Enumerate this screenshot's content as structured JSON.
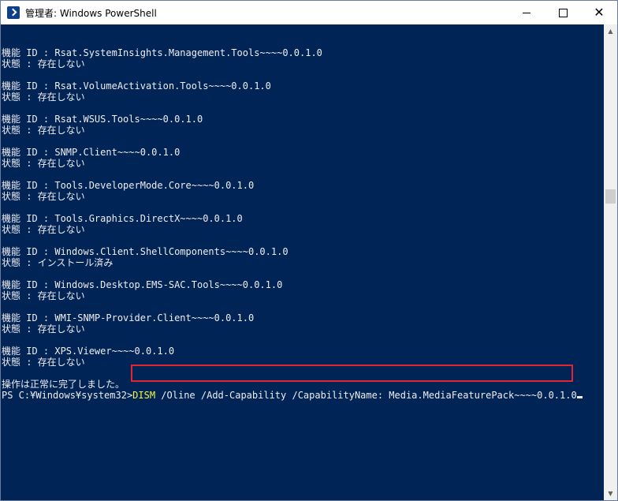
{
  "window": {
    "title": "管理者: Windows PowerShell",
    "controls": {
      "minimize": "",
      "maximize": "",
      "close": "✕"
    }
  },
  "console": {
    "lines": [
      "機能 ID : Rsat.SystemInsights.Management.Tools~~~~0.0.1.0",
      "状態 : 存在しない",
      "",
      "機能 ID : Rsat.VolumeActivation.Tools~~~~0.0.1.0",
      "状態 : 存在しない",
      "",
      "機能 ID : Rsat.WSUS.Tools~~~~0.0.1.0",
      "状態 : 存在しない",
      "",
      "機能 ID : SNMP.Client~~~~0.0.1.0",
      "状態 : 存在しない",
      "",
      "機能 ID : Tools.DeveloperMode.Core~~~~0.0.1.0",
      "状態 : 存在しない",
      "",
      "機能 ID : Tools.Graphics.DirectX~~~~0.0.1.0",
      "状態 : 存在しない",
      "",
      "機能 ID : Windows.Client.ShellComponents~~~~0.0.1.0",
      "状態 : インストール済み",
      "",
      "機能 ID : Windows.Desktop.EMS-SAC.Tools~~~~0.0.1.0",
      "状態 : 存在しない",
      "",
      "機能 ID : WMI-SNMP-Provider.Client~~~~0.0.1.0",
      "状態 : 存在しない",
      "",
      "機能 ID : XPS.Viewer~~~~0.0.1.0",
      "状態 : 存在しない",
      "",
      "操作は正常に完了しました。"
    ],
    "prompt": "PS C:¥Windows¥system32>",
    "command_keyword": "DISM",
    "command_args": " /Oline /Add-Capability /CapabilityName: Media.MediaFeaturePack~~~~0.0.1.0"
  },
  "colors": {
    "console_bg": "#012456",
    "console_text": "#eeedf0",
    "keyword": "#f5f543",
    "highlight_border": "#e0262e"
  }
}
